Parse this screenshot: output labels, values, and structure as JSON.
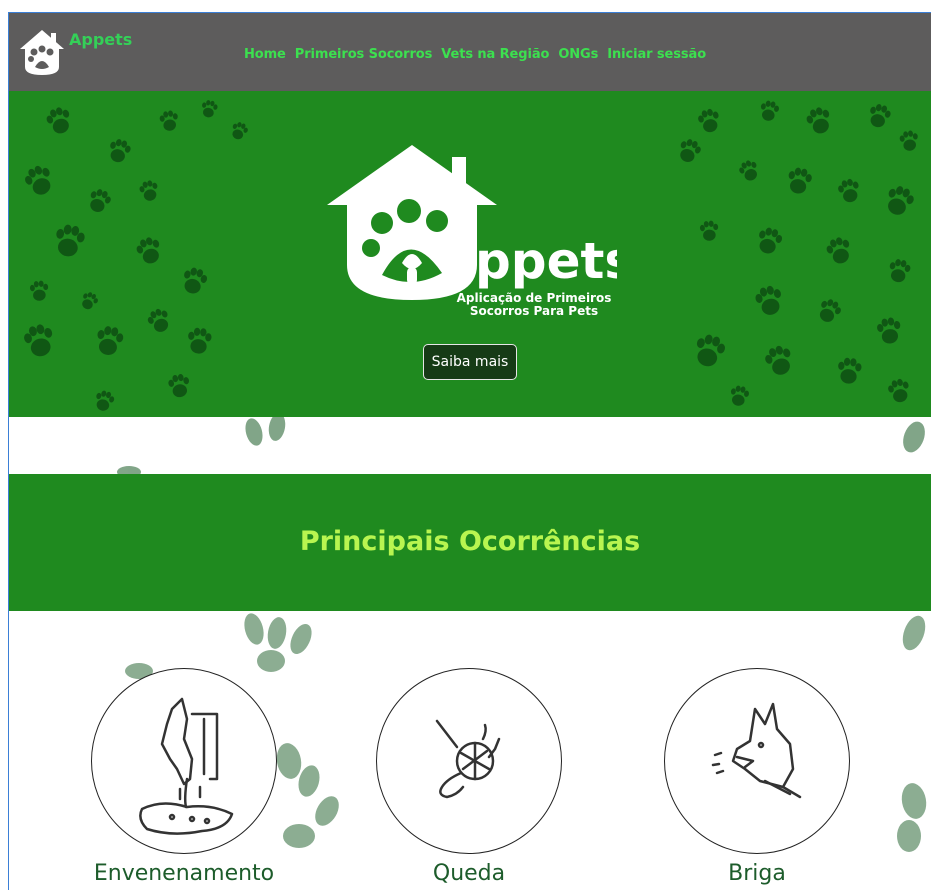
{
  "brand": {
    "name": "Appets",
    "logo_icon": "paw-house-icon"
  },
  "nav": {
    "items": [
      {
        "label": "Home"
      },
      {
        "label": "Primeiros Socorros"
      },
      {
        "label": "Vets na Região"
      },
      {
        "label": "ONGs"
      },
      {
        "label": "Iniciar sessão"
      }
    ]
  },
  "hero": {
    "logo_text": "ppets",
    "subtitle_line1": "Aplicação de Primeiros",
    "subtitle_line2": "Socorros Para Pets",
    "cta_label": "Saiba mais"
  },
  "section": {
    "title": "Principais Ocorrências"
  },
  "cards": [
    {
      "label": "Envenenamento",
      "icon": "poisoned-dog-icon"
    },
    {
      "label": "Queda",
      "icon": "fall-injury-icon"
    },
    {
      "label": "Briga",
      "icon": "angry-dog-icon"
    }
  ],
  "colors": {
    "navbar": "#5d5c5c",
    "nav_link": "#3ce04f",
    "hero_green": "#1f8a1f",
    "title_lime": "#b8f550",
    "card_label": "#1d5c2b"
  }
}
